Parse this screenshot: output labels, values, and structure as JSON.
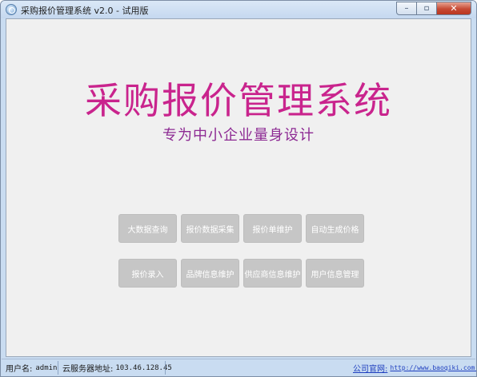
{
  "window": {
    "title": "采购报价管理系统  v2.0  - 试用版",
    "minimize_icon": "minimize-icon",
    "maximize_icon": "maximize-icon",
    "close_icon": "close-icon",
    "min_glyph": "–",
    "max_glyph": "▫",
    "close_glyph": "✕"
  },
  "main": {
    "title": "采购报价管理系统",
    "subtitle": "专为中小企业量身设计",
    "title_color": "#c9248d",
    "subtitle_color": "#8d2a93"
  },
  "buttons": {
    "row1": [
      "大数据查询",
      "报价数据采集",
      "报价单维护",
      "自动生成价格"
    ],
    "row2": [
      "报价录入",
      "品牌信息维护",
      "供应商信息维护",
      "用户信息管理"
    ]
  },
  "status": {
    "user_label": "用户名:",
    "user_value": "admin",
    "server_label": "云服务器地址:",
    "server_value": "103.46.128.45",
    "site_label": "公司官网:",
    "site_value": "http://www.baoqiki.com.cn"
  }
}
